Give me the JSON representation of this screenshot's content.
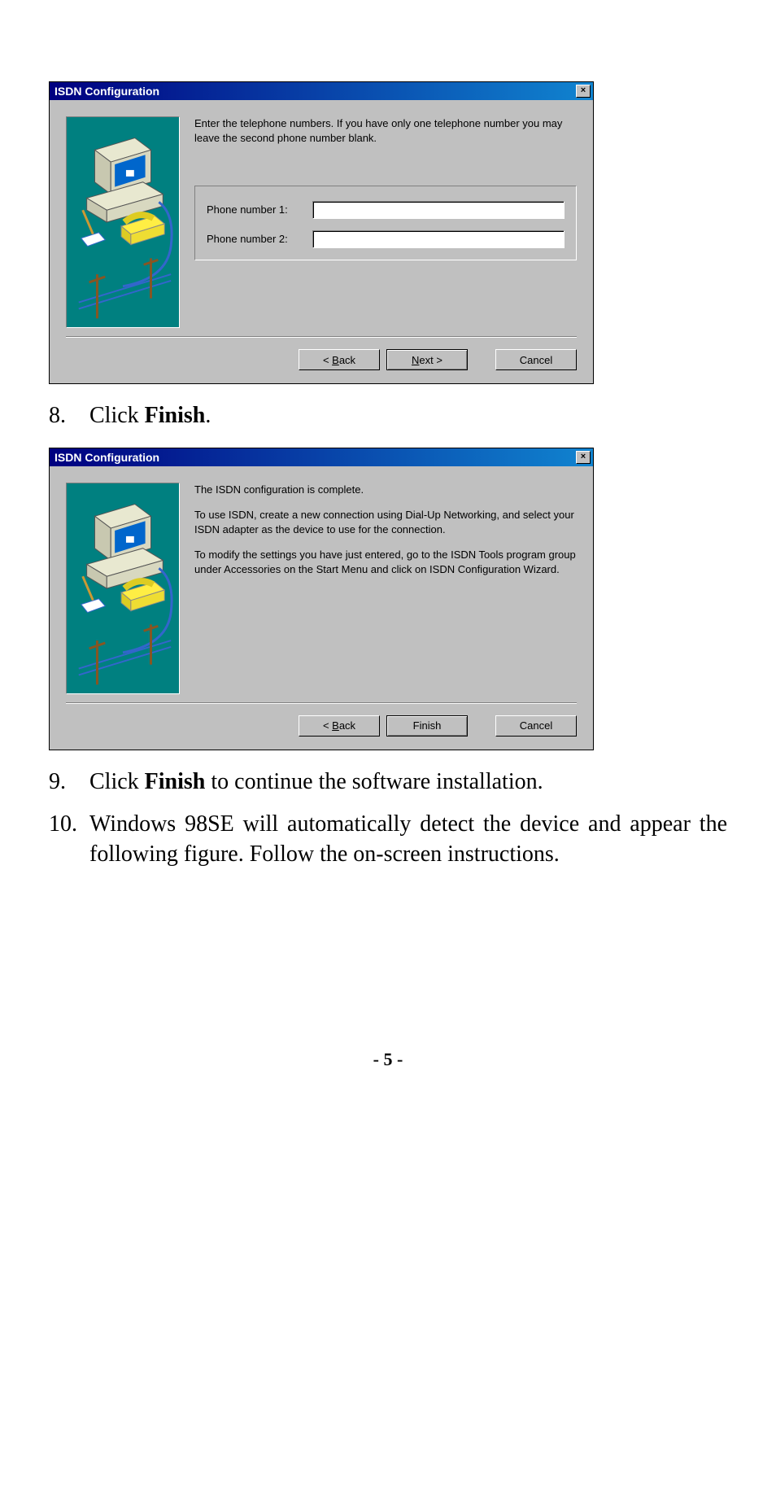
{
  "dialog1": {
    "title": "ISDN Configuration",
    "close": "×",
    "instruction": "Enter the telephone numbers.  If you have only one telephone number you may leave the second phone number blank.",
    "phone1_label": "Phone number 1:",
    "phone1_value": "",
    "phone2_label": "Phone number 2:",
    "phone2_value": "",
    "back_prefix": "< ",
    "back_u": "B",
    "back_suffix": "ack",
    "next_u": "N",
    "next_suffix": "ext >",
    "cancel": "Cancel"
  },
  "step8": {
    "num": "8.",
    "prefix": "Click ",
    "bold": "Finish",
    "suffix": "."
  },
  "dialog2": {
    "title": "ISDN Configuration",
    "close": "×",
    "para1": "The ISDN configuration is complete.",
    "para2": "To use ISDN, create a new connection using Dial-Up Networking, and select your ISDN adapter as the device to use for the connection.",
    "para3": "To modify the settings you have just entered, go to the ISDN Tools program group under Accessories on the Start Menu and click on ISDN Configuration Wizard.",
    "back_prefix": "< ",
    "back_u": "B",
    "back_suffix": "ack",
    "finish": "Finish",
    "cancel": "Cancel"
  },
  "step9": {
    "num": "9.",
    "prefix": "Click ",
    "bold": "Finish",
    "suffix": " to continue the software installation."
  },
  "step10": {
    "num": "10.",
    "text": "Windows 98SE will automatically detect the device and appear the following figure. Follow the on-screen instructions."
  },
  "page_number": "- 5 -"
}
